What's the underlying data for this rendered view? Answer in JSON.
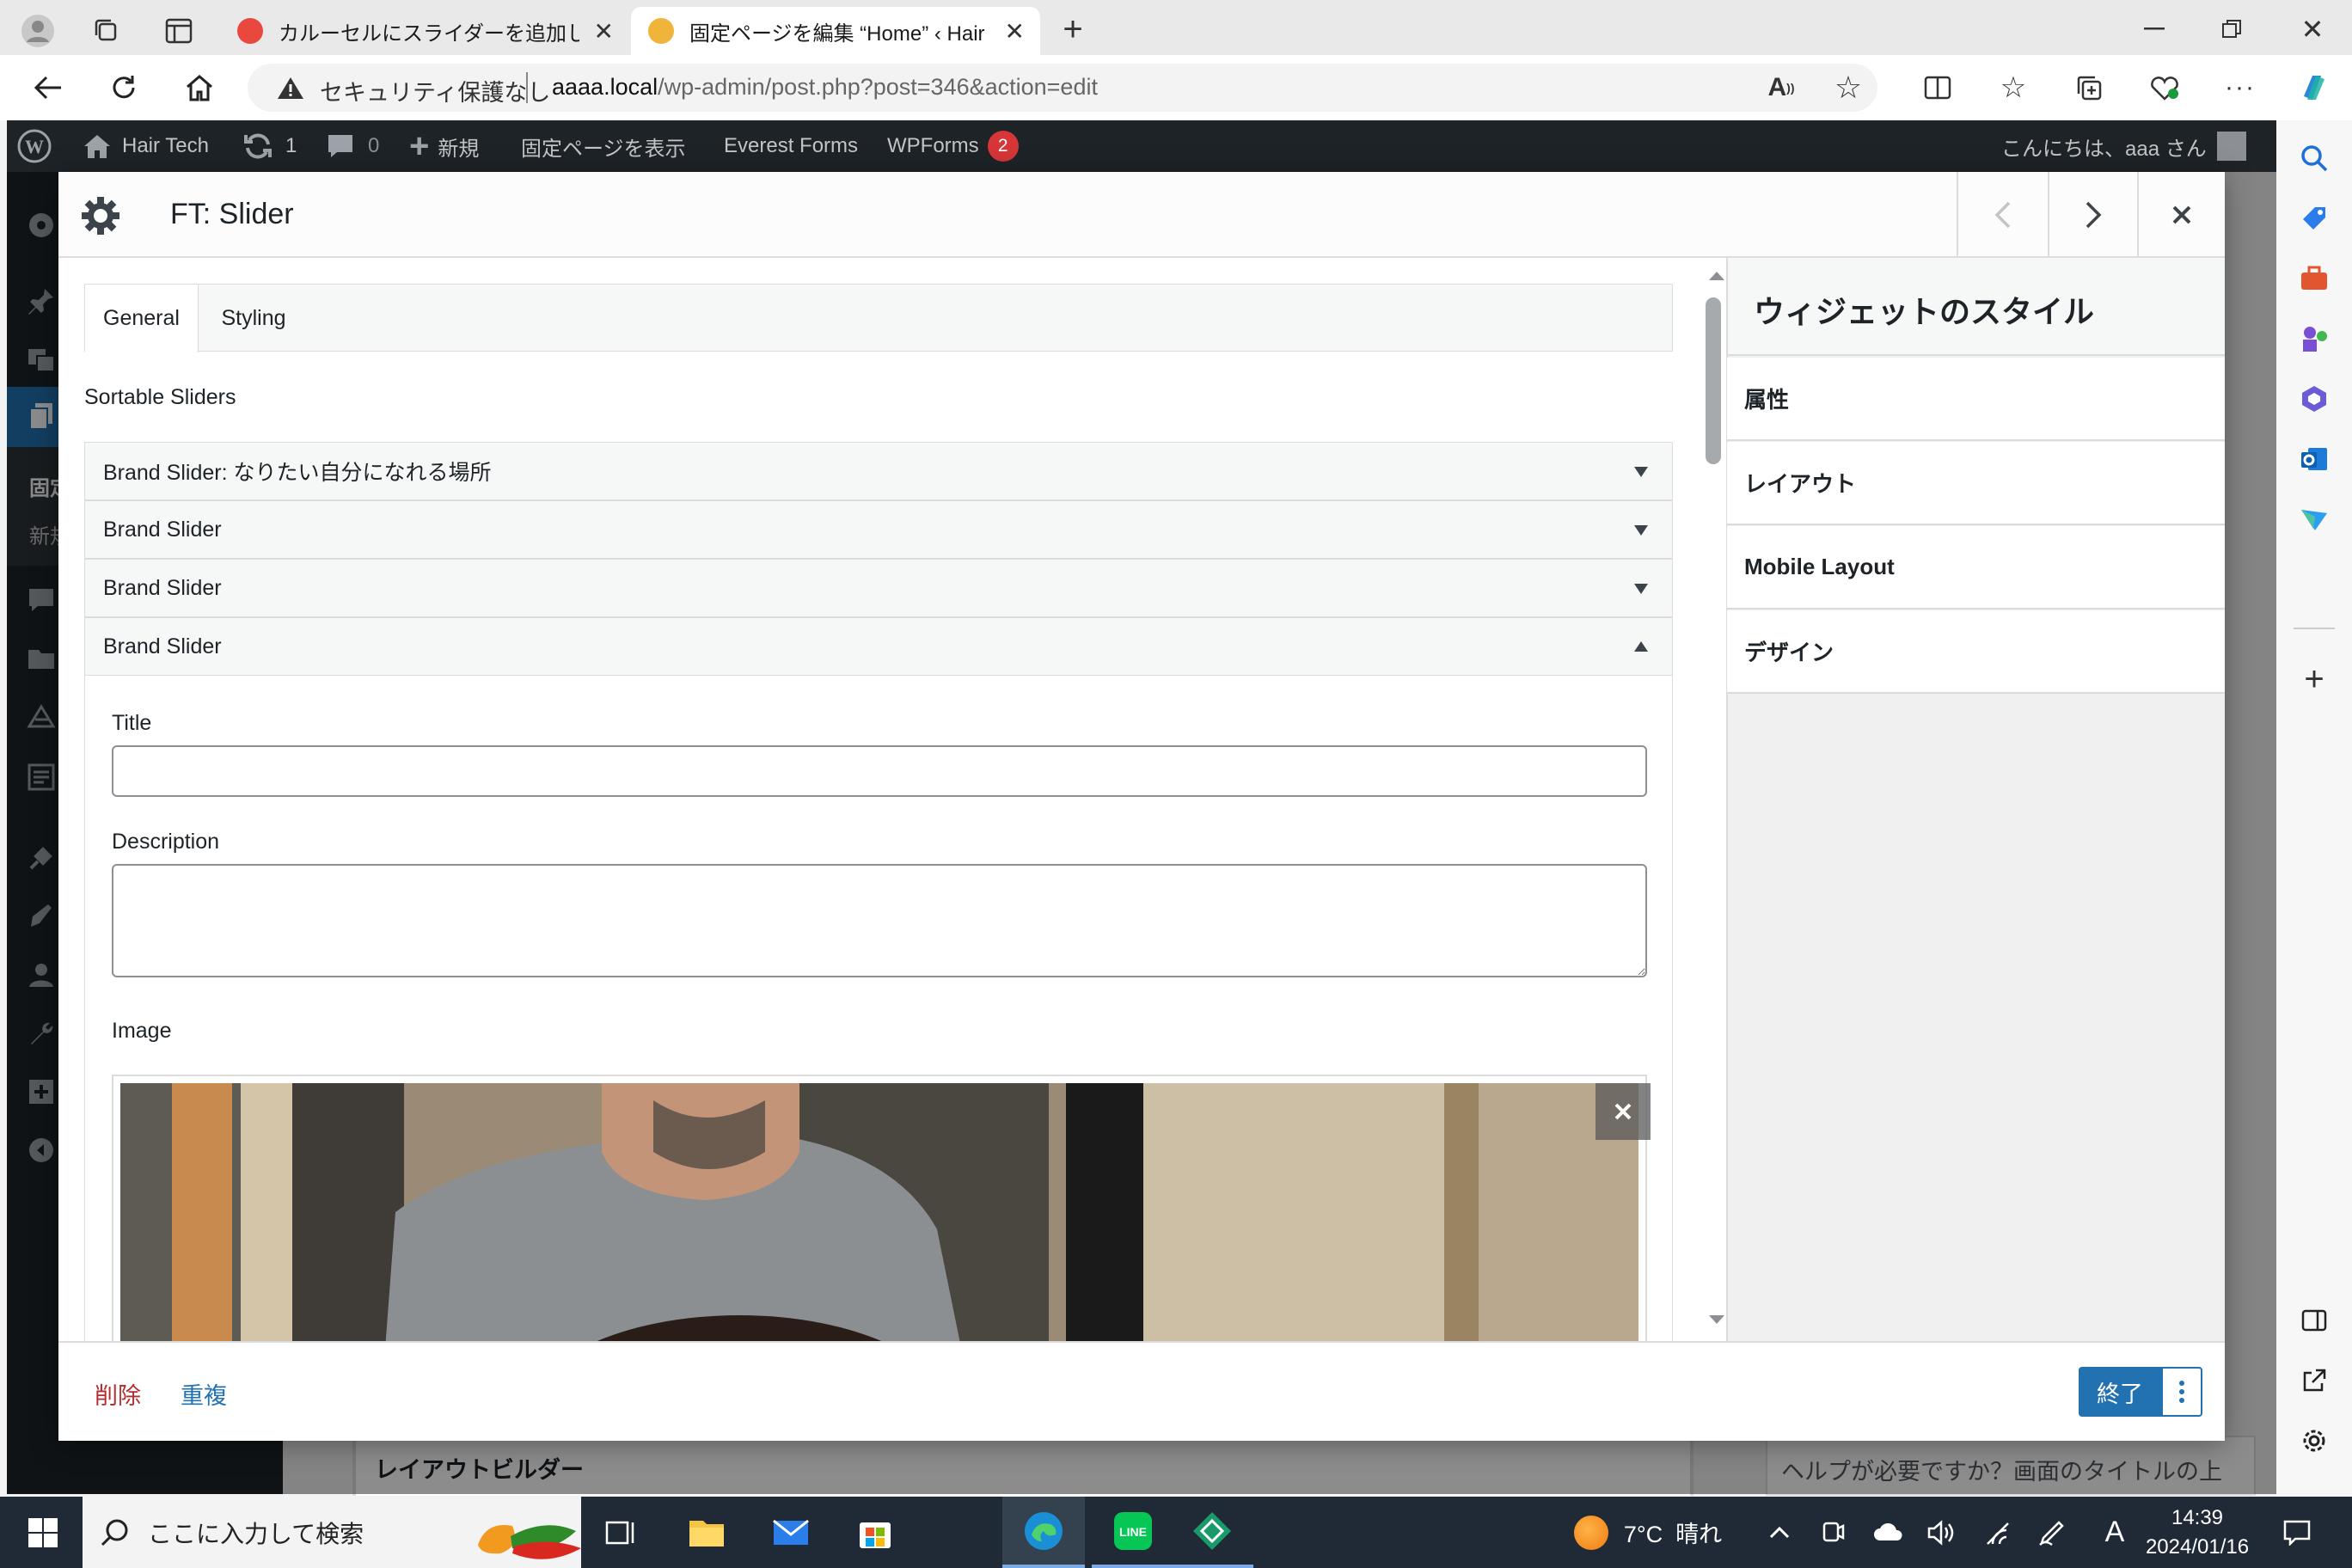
{
  "browser": {
    "tabs": [
      {
        "title": "カルーセルにスライダーを追加しよう | プ",
        "active": false
      },
      {
        "title": "固定ページを編集 “Home” ‹ Hair Te",
        "active": true
      }
    ],
    "security_label": "セキュリティ保護なし",
    "url_host": "aaaa.local",
    "url_path": "/wp-admin/post.php?post=346&action=edit"
  },
  "wp_adminbar": {
    "site_name": "Hair Tech",
    "updates_count": "1",
    "comments_count": "0",
    "new_label": "新規",
    "view_page": "固定ページを表示",
    "everest_forms": "Everest Forms",
    "wpforms": "WPForms",
    "wpforms_badge": "2",
    "greeting": "こんにちは、aaa さん"
  },
  "sidebar_partial": {
    "item1": "固定",
    "item2": "新規"
  },
  "modal": {
    "title": "FT: Slider",
    "tabs": [
      {
        "label": "General",
        "active": true
      },
      {
        "label": "Styling",
        "active": false
      }
    ],
    "section_label": "Sortable Sliders",
    "sliders": [
      {
        "label": "Brand Slider: なりたい自分になれる場所",
        "open": false
      },
      {
        "label": "Brand Slider",
        "open": false
      },
      {
        "label": "Brand Slider",
        "open": false
      },
      {
        "label": "Brand Slider",
        "open": true
      }
    ],
    "fields": {
      "title_label": "Title",
      "title_value": "",
      "description_label": "Description",
      "description_value": "",
      "image_label": "Image"
    },
    "right_panel": {
      "heading": "ウィジェットのスタイル",
      "items": [
        "属性",
        "レイアウト",
        "Mobile Layout",
        "デザイン"
      ]
    },
    "footer": {
      "delete": "削除",
      "duplicate": "重複",
      "done": "終了"
    }
  },
  "background": {
    "layout_builder": "レイアウトビルダー",
    "help_text": "ヘルプが必要ですか？画面のタイトルの上"
  },
  "taskbar": {
    "search_placeholder": "ここに入力して検索",
    "weather": "7°C  晴れ",
    "ime": "A",
    "time": "14:39",
    "date": "2024/01/16"
  },
  "colors": {
    "wp_dark": "#1d2327",
    "wp_blue": "#2271b1",
    "delete_red": "#b32d2e",
    "badge_red": "#d63638",
    "taskbar": "#1f2a36"
  }
}
